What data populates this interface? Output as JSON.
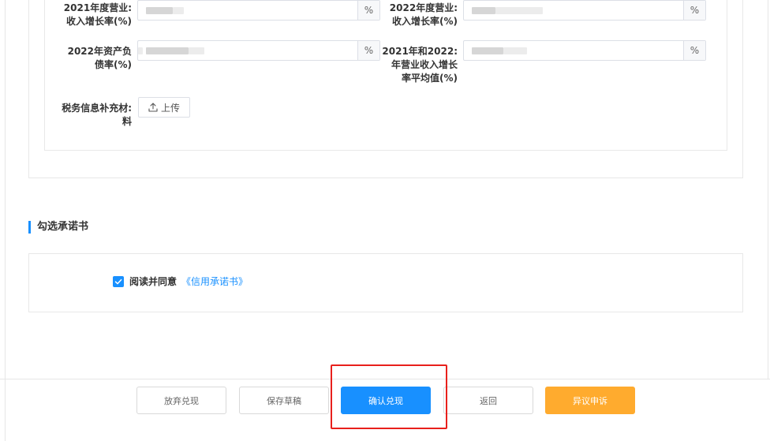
{
  "form": {
    "row1": {
      "left_label": "2021年度营业:\n收入增长率(%)",
      "left_suffix": "%",
      "right_label": "2022年度营业:\n收入增长率(%)",
      "right_suffix": "%"
    },
    "row2": {
      "left_label": "2022年资产负\n债率(%)",
      "left_suffix": "%",
      "right_label": "2021年和2022:\n年营业收入增长\n率平均值(%)",
      "right_suffix": "%"
    },
    "upload": {
      "label": "税务信息补充材:\n料",
      "button": "上传"
    }
  },
  "commitment": {
    "section_title": "勾选承诺书",
    "checked": true,
    "agree_text": "阅读并同意",
    "link_text": "《信用承诺书》"
  },
  "footer": {
    "buttons": [
      {
        "label": "放弃兑现"
      },
      {
        "label": "保存草稿"
      },
      {
        "label": "确认兑现"
      },
      {
        "label": "返回"
      },
      {
        "label": "异议申诉"
      }
    ]
  },
  "colors": {
    "primary": "#1890ff",
    "warning": "#ffab2e",
    "highlight": "#e8201c"
  }
}
